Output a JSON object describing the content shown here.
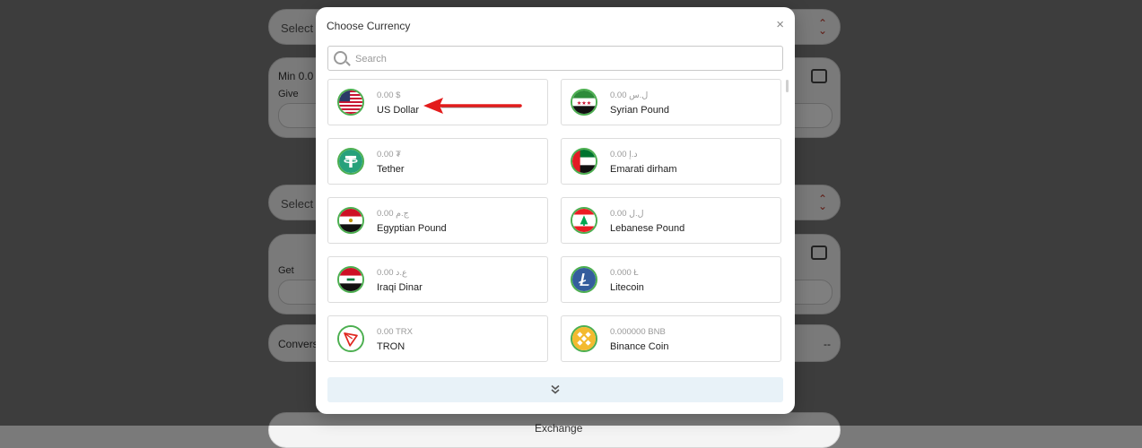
{
  "background": {
    "select_label_1": "Select C",
    "min_label": "Min 0.0",
    "give_label": "Give",
    "select_label_2": "Select C",
    "get_label": "Get",
    "conversion_label": "Convers",
    "conversion_value": "--",
    "exchange_label": "Exchange"
  },
  "modal": {
    "title": "Choose Currency",
    "close_label": "×",
    "search": {
      "placeholder": "Search",
      "value": ""
    }
  },
  "currencies": [
    {
      "amount": "0.00 $",
      "name": "US Dollar",
      "icon": "us-flag-icon"
    },
    {
      "amount": "0.00 ل.س",
      "name": "Syrian Pound",
      "icon": "syria-flag-icon"
    },
    {
      "amount": "0.00 ₮",
      "name": "Tether",
      "icon": "tether-icon"
    },
    {
      "amount": "0.00 د.إ",
      "name": "Emarati dirham",
      "icon": "uae-flag-icon"
    },
    {
      "amount": "0.00 ج.م",
      "name": "Egyptian Pound",
      "icon": "egypt-flag-icon"
    },
    {
      "amount": "0.00 ل.ل",
      "name": "Lebanese Pound",
      "icon": "lebanon-flag-icon"
    },
    {
      "amount": "0.00 ع.د",
      "name": "Iraqi Dinar",
      "icon": "iraq-flag-icon"
    },
    {
      "amount": "0.000 Ł",
      "name": "Litecoin",
      "icon": "litecoin-icon"
    },
    {
      "amount": "0.00 TRX",
      "name": "TRON",
      "icon": "tron-icon"
    },
    {
      "amount": "0.000000 BNB",
      "name": "Binance Coin",
      "icon": "binance-icon"
    }
  ],
  "colors": {
    "icon_ring": "#4caf50",
    "arrow": "#e31b1b",
    "load_more_bg": "#e8f2f8"
  }
}
